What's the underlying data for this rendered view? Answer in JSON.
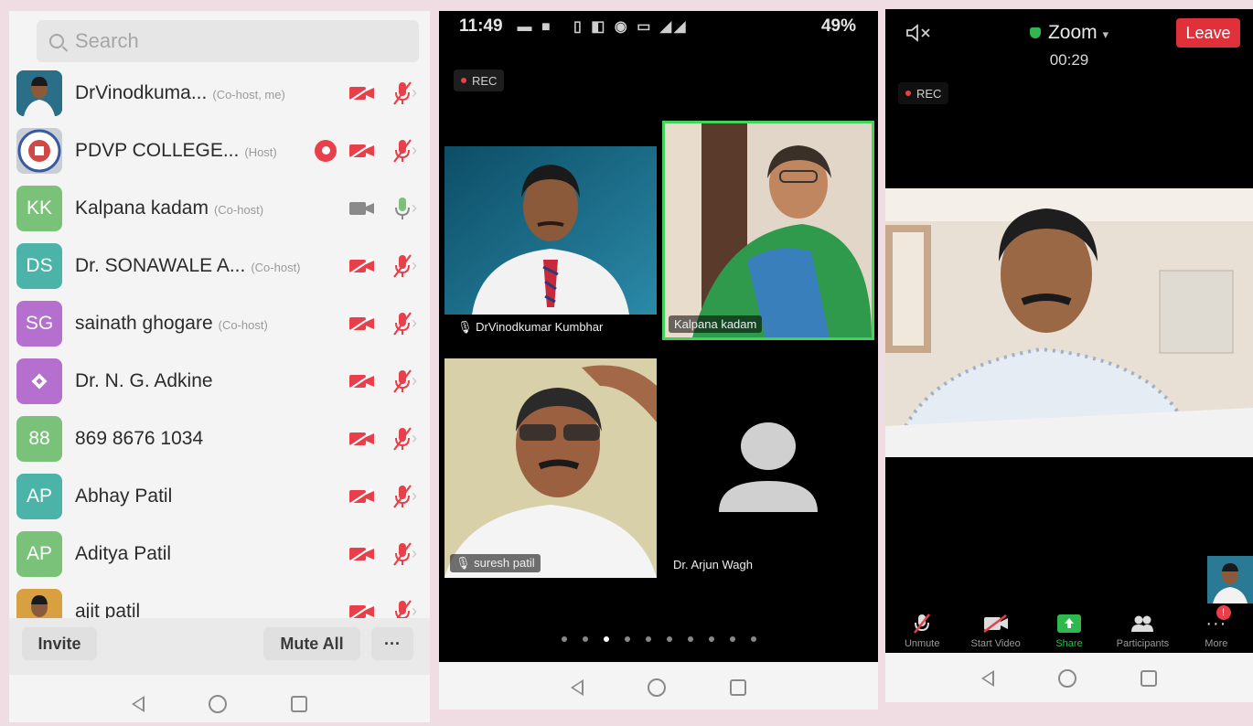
{
  "participants_panel": {
    "search_placeholder": "Search",
    "participants": [
      {
        "name": "DrVinodkuma...",
        "tag": "(Co-host, me)",
        "initials": "",
        "avatar_color": "#2a6f87",
        "avatar_type": "photo",
        "recording": false,
        "video_on": false,
        "mic_on": false
      },
      {
        "name": "PDVP COLLEGE...",
        "tag": "(Host)",
        "initials": "",
        "avatar_color": "#c9ced6",
        "avatar_type": "logo",
        "recording": true,
        "video_on": false,
        "mic_on": false
      },
      {
        "name": "Kalpana kadam",
        "tag": "(Co-host)",
        "initials": "KK",
        "avatar_color": "#7ac27a",
        "avatar_type": "initials",
        "recording": false,
        "video_on": true,
        "mic_on": true
      },
      {
        "name": "Dr. SONAWALE A...",
        "tag": "(Co-host)",
        "initials": "DS",
        "avatar_color": "#4bb3a7",
        "avatar_type": "initials",
        "recording": false,
        "video_on": false,
        "mic_on": false
      },
      {
        "name": "sainath ghogare",
        "tag": "(Co-host)",
        "initials": "SG",
        "avatar_color": "#b56fcf",
        "avatar_type": "initials",
        "recording": false,
        "video_on": false,
        "mic_on": false
      },
      {
        "name": "Dr. N. G. Adkine",
        "tag": "",
        "initials": "",
        "avatar_color": "#b56fcf",
        "avatar_type": "diamond",
        "recording": false,
        "video_on": false,
        "mic_on": false
      },
      {
        "name": "869 8676 1034",
        "tag": "",
        "initials": "88",
        "avatar_color": "#7ac27a",
        "avatar_type": "initials",
        "recording": false,
        "video_on": false,
        "mic_on": false
      },
      {
        "name": "Abhay Patil",
        "tag": "",
        "initials": "AP",
        "avatar_color": "#4bb3a7",
        "avatar_type": "initials",
        "recording": false,
        "video_on": false,
        "mic_on": false
      },
      {
        "name": "Aditya Patil",
        "tag": "",
        "initials": "AP",
        "avatar_color": "#7ac27a",
        "avatar_type": "initials",
        "recording": false,
        "video_on": false,
        "mic_on": false
      },
      {
        "name": "ajit patil",
        "tag": "",
        "initials": "",
        "avatar_color": "#d8a040",
        "avatar_type": "photo",
        "recording": false,
        "video_on": false,
        "mic_on": false
      }
    ],
    "invite_label": "Invite",
    "mute_all_label": "Mute All",
    "more_label": "···"
  },
  "gallery_panel": {
    "status_time": "11:49",
    "status_battery": "49%",
    "rec_label": "REC",
    "tiles": [
      {
        "name": "DrVinodkumar Kumbhar",
        "type": "video",
        "muted": true,
        "active": false
      },
      {
        "name": "Kalpana kadam",
        "type": "video",
        "muted": false,
        "active": true
      },
      {
        "name": "suresh patil",
        "type": "video",
        "muted": true,
        "active": false
      },
      {
        "name": "Dr. Arjun Wagh",
        "type": "avatar",
        "muted": false,
        "active": false
      }
    ],
    "page_dots": 10,
    "active_dot": 3
  },
  "meeting_panel": {
    "title": "Zoom",
    "timer": "00:29",
    "leave_label": "Leave",
    "rec_label": "REC",
    "toolbar": [
      {
        "label": "Unmute",
        "icon": "mic-muted-icon"
      },
      {
        "label": "Start Video",
        "icon": "video-off-icon"
      },
      {
        "label": "Share",
        "icon": "share-screen-icon"
      },
      {
        "label": "Participants",
        "icon": "participants-icon"
      },
      {
        "label": "More",
        "icon": "more-icon"
      }
    ],
    "more_badge": "!"
  },
  "colors": {
    "accent_red": "#e8404a",
    "leave_red": "#e0313a",
    "active_green": "#43d35a",
    "share_green": "#2eb84e"
  }
}
